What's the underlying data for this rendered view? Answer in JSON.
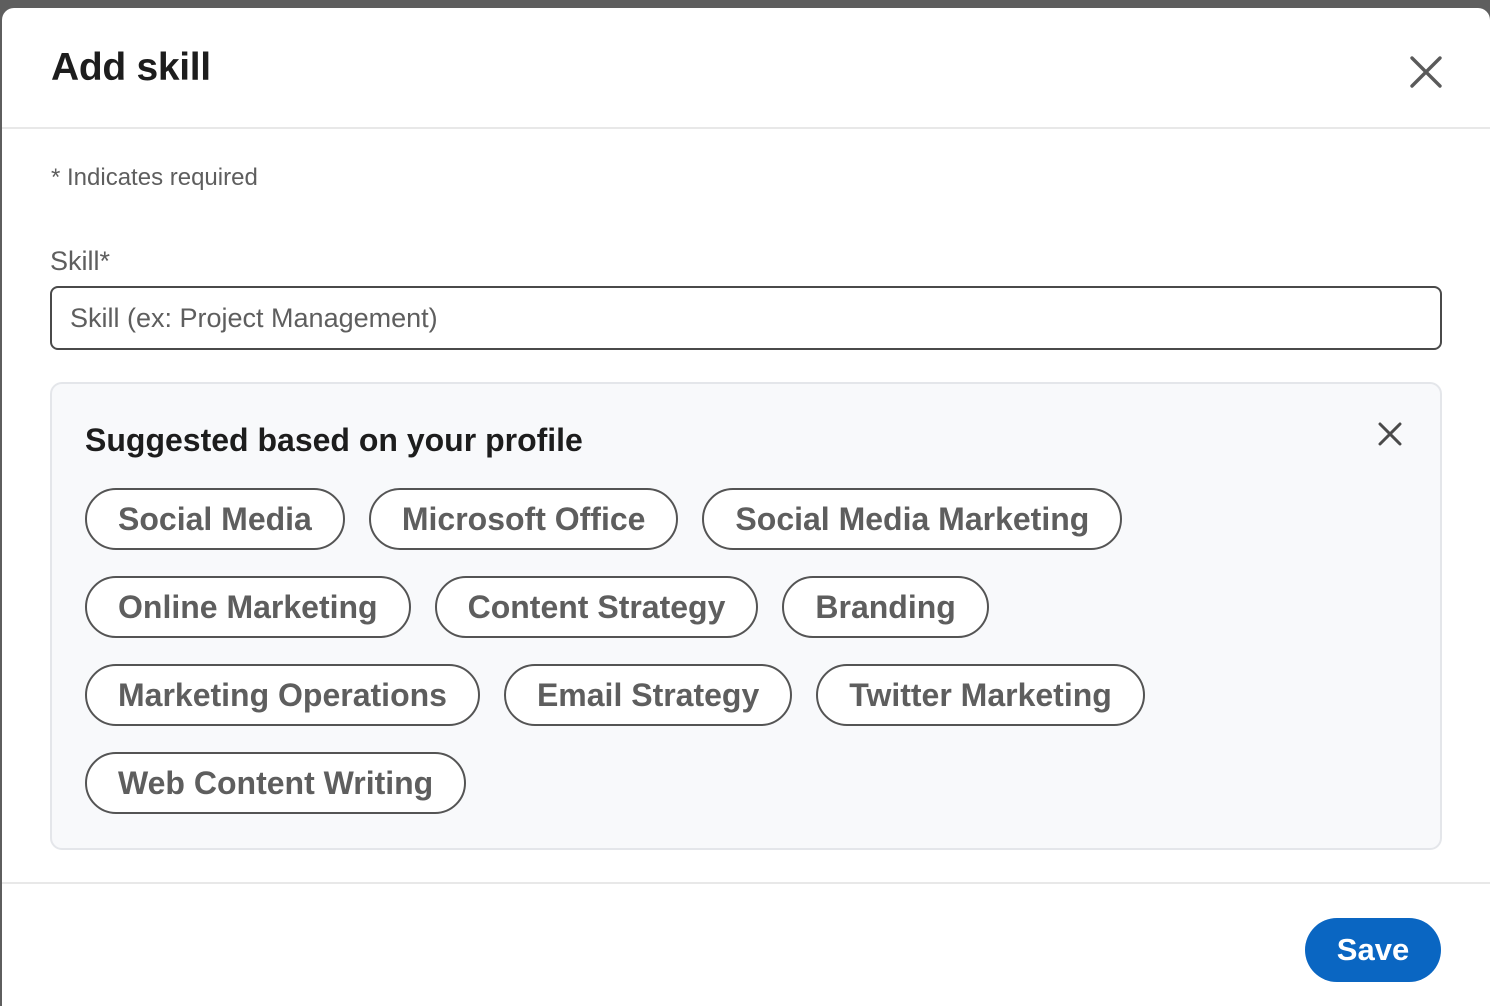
{
  "modal": {
    "title": "Add skill",
    "close_icon": "close-icon"
  },
  "form": {
    "required_note": "* Indicates required",
    "skill_label": "Skill*",
    "skill_value": "",
    "skill_placeholder": "Skill (ex: Project Management)"
  },
  "suggestions": {
    "title": "Suggested based on your profile",
    "dismiss_icon": "close-icon",
    "items": [
      "Social Media",
      "Microsoft Office",
      "Social Media Marketing",
      "Online Marketing",
      "Content Strategy",
      "Branding",
      "Marketing Operations",
      "Email Strategy",
      "Twitter Marketing",
      "Web Content Writing"
    ]
  },
  "footer": {
    "save_label": "Save"
  },
  "colors": {
    "primary": "#0a66c2",
    "text": "#1d1d1d",
    "muted_text": "#5e5e5e",
    "suggest_bg": "#f8f9fb"
  }
}
